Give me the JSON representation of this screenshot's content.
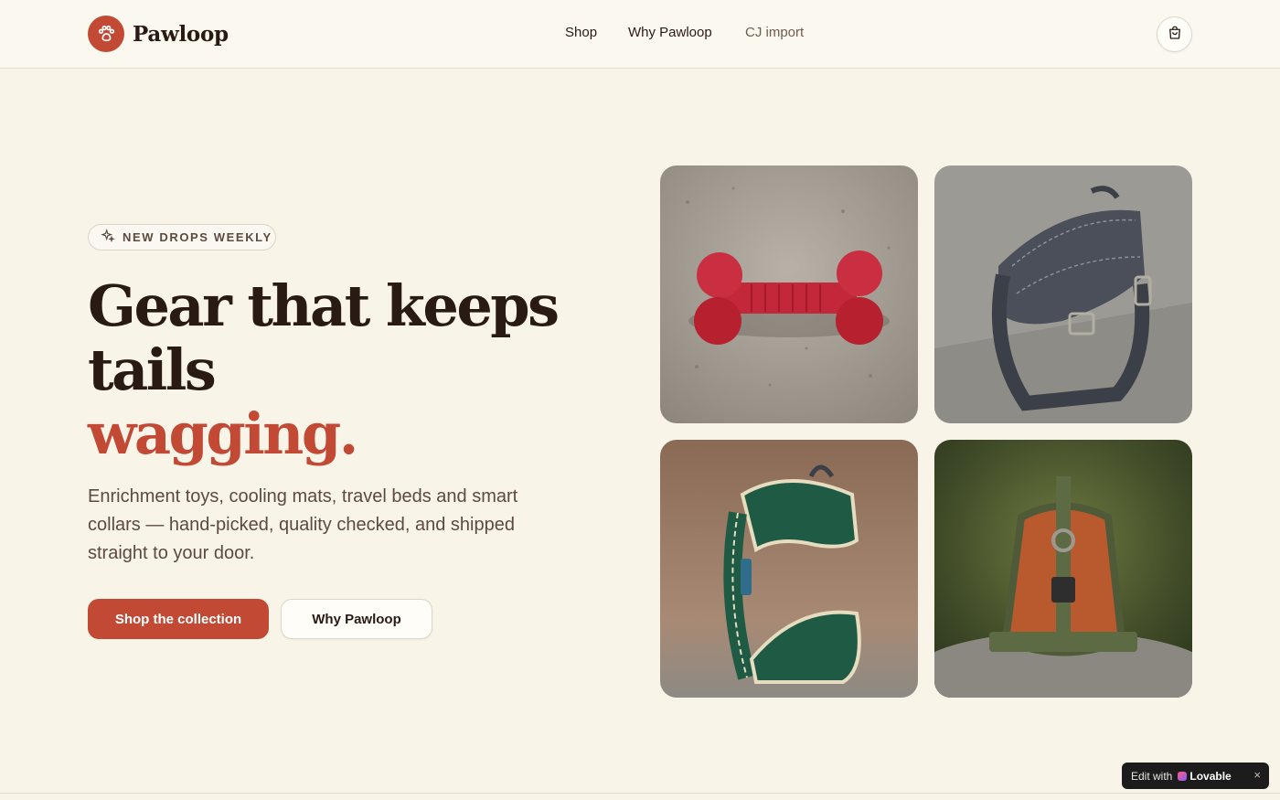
{
  "header": {
    "brand": "Pawloop",
    "nav": [
      {
        "label": "Shop"
      },
      {
        "label": "Why Pawloop"
      },
      {
        "label": "CJ import"
      }
    ],
    "cart_icon": "shopping-bag-icon"
  },
  "hero": {
    "badge": "NEW DROPS WEEKLY",
    "badge_icon": "sparkles-icon",
    "headline_line1": "Gear that keeps",
    "headline_line2": "tails",
    "headline_accent": "wagging.",
    "subtext": "Enrichment toys, cooling mats, travel beds and smart collars — hand-picked, quality checked, and shipped straight to your door.",
    "primary_cta": "Shop the collection",
    "secondary_cta": "Why Pawloop"
  },
  "gallery": [
    {
      "name": "red-bone-chew-toy-image"
    },
    {
      "name": "grey-dog-harness-image"
    },
    {
      "name": "green-dog-harness-image"
    },
    {
      "name": "orange-tactical-harness-image"
    }
  ],
  "lovable": {
    "prefix": "Edit with",
    "brand": "Lovable",
    "close": "×"
  },
  "colors": {
    "accent": "#c24a34",
    "background": "#f8f4e8",
    "text": "#2a1a14"
  }
}
